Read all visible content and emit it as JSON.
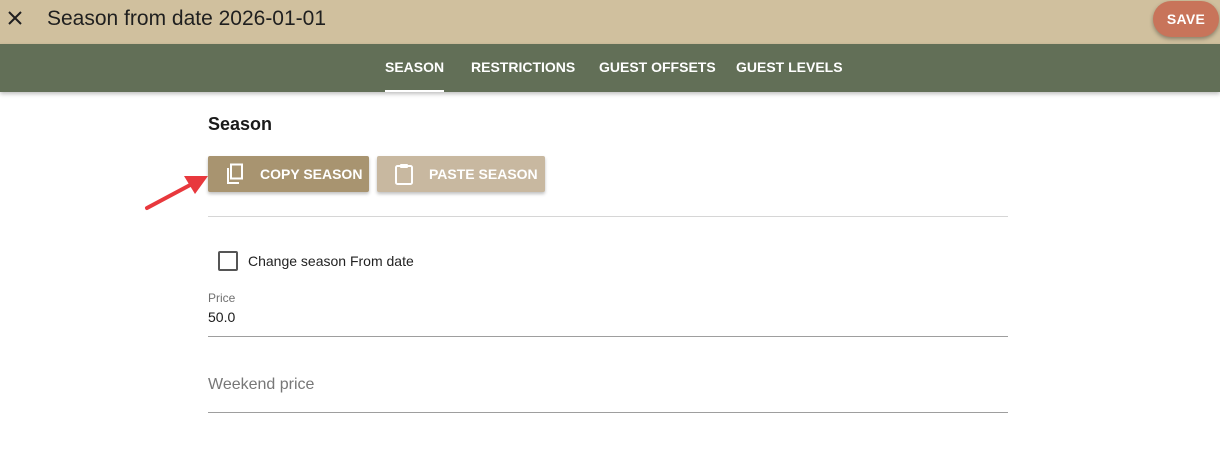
{
  "header": {
    "title": "Season from date 2026-01-01",
    "close_icon": "close-icon",
    "save_label": "SAVE",
    "colors": {
      "topbar": "#d0c09e",
      "save": "#c8745a"
    }
  },
  "tabs": [
    {
      "label": "SEASON",
      "active": true
    },
    {
      "label": "RESTRICTIONS",
      "active": false
    },
    {
      "label": "GUEST OFFSETS",
      "active": false
    },
    {
      "label": "GUEST LEVELS",
      "active": false
    }
  ],
  "tabbar_color": "#626f57",
  "content": {
    "section_title": "Season",
    "copy_button": {
      "label": "COPY SEASON",
      "icon": "copy-icon",
      "color": "#a89470"
    },
    "paste_button": {
      "label": "PASTE SEASON",
      "icon": "clipboard-icon",
      "color": "#c8b8a0"
    },
    "checkbox": {
      "label": "Change season From date",
      "checked": false
    },
    "price": {
      "label": "Price",
      "value": "50.0"
    },
    "weekend_price": {
      "placeholder": "Weekend price"
    }
  },
  "annotation": {
    "icon": "red-arrow-icon",
    "color": "#e8383d"
  }
}
